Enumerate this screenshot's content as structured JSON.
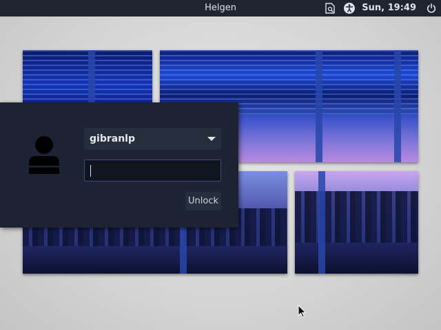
{
  "topbar": {
    "hostname": "Helgen",
    "clock": "Sun, 19:49",
    "icons": [
      "document-search-icon",
      "accessibility-icon",
      "power-icon"
    ]
  },
  "lock": {
    "username": "gibranlp",
    "password_value": "",
    "unlock_label": "Unlock"
  },
  "colors": {
    "panel": "#1d2332",
    "topbar": "#1f2430",
    "field": "#262d3d",
    "focus_border": "#3d4d78"
  }
}
